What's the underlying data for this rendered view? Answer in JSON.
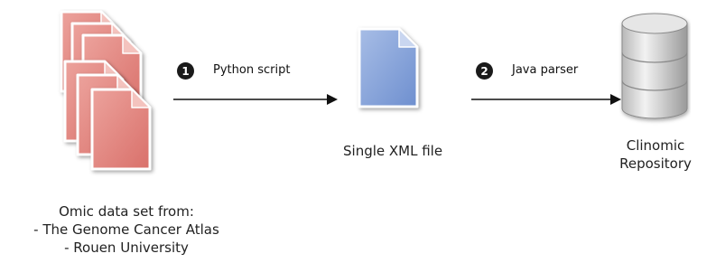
{
  "steps": [
    {
      "number": "1",
      "label": "Python script"
    },
    {
      "number": "2",
      "label": "Java parser"
    }
  ],
  "source": {
    "lines": [
      "Omic data set from:",
      "- The Genome Cancer Atlas",
      "- Rouen University"
    ]
  },
  "middle": {
    "label": "Single XML file"
  },
  "target": {
    "lines": [
      "Clinomic",
      "Repository"
    ]
  },
  "colors": {
    "source_file": "#e07f78",
    "xml_file": "#7f9fd6",
    "database": "#d9d9d9",
    "arrow": "#111111"
  },
  "icons": [
    "document-stack-icon",
    "document-icon",
    "database-icon"
  ]
}
